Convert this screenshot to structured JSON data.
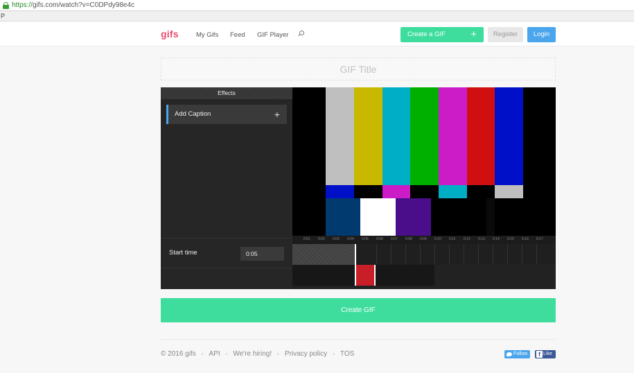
{
  "browser": {
    "url_scheme": "https://",
    "url_rest": "gifs.com/watch?v=C0DPdy98e4c",
    "bookmark_text": "P"
  },
  "header": {
    "logo": "gifs",
    "nav": [
      "My Gifs",
      "Feed",
      "GIF Player"
    ],
    "create_label": "Create a GIF",
    "create_plus": "+",
    "register_label": "Register",
    "login_label": "Login"
  },
  "title_input": {
    "placeholder": "GIF Title",
    "value": ""
  },
  "editor": {
    "effects_heading": "Effects",
    "add_caption_label": "Add Caption",
    "add_caption_plus": "+",
    "start_time_label": "Start time",
    "start_time_value": "0:05",
    "ticks": [
      "0:01",
      "0:02",
      "0:03",
      "0:04",
      "0:05",
      "0:06",
      "0:07",
      "0:08",
      "0:09",
      "0:10",
      "0:11",
      "0:12",
      "0:13",
      "0:14",
      "0:15",
      "0:16",
      "0:17"
    ]
  },
  "create_gif_button": "Create GIF",
  "footer": {
    "copyright": "© 2016 gifs",
    "links": [
      "API",
      "We're hiring!",
      "Privacy policy",
      "TOS"
    ],
    "follow_label": "Follow",
    "like_label": "Like"
  },
  "colors": {
    "accent_green": "#3edd9e",
    "login_blue": "#4aa5ec",
    "logo_pink": "#e84b6f",
    "handle_red": "#c81e28"
  }
}
